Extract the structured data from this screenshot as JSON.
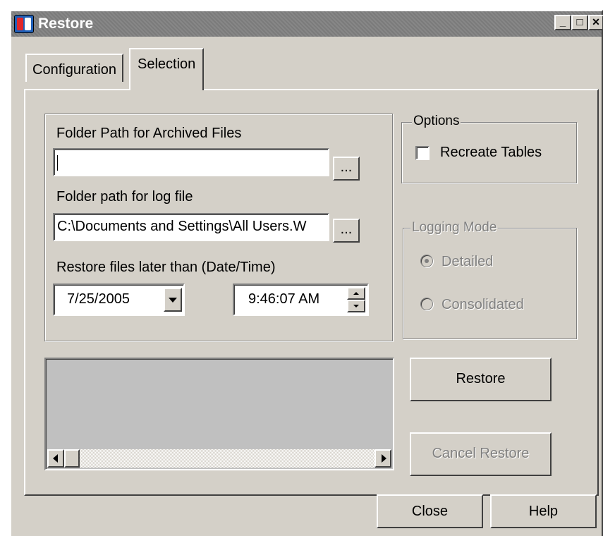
{
  "window": {
    "title": "Restore",
    "minimize_glyph": "_",
    "maximize_glyph": "□",
    "close_glyph": "✕"
  },
  "tabs": [
    {
      "label": "Configuration",
      "active": false
    },
    {
      "label": "Selection",
      "active": true
    }
  ],
  "selection": {
    "archived_folder_label": "Folder Path for Archived Files",
    "archived_folder_value": "",
    "log_folder_label": "Folder path for log file",
    "log_folder_value": "C:\\Documents and Settings\\All Users.W",
    "browse_label": "...",
    "date_time_label": "Restore files later than (Date/Time)",
    "date_value": "7/25/2005",
    "time_value": "9:46:07 AM"
  },
  "options": {
    "caption": "Options",
    "recreate_tables_label": "Recreate Tables",
    "recreate_tables_checked": false
  },
  "logging_mode": {
    "caption": "Logging Mode",
    "enabled": false,
    "options": [
      {
        "label": "Detailed",
        "selected": true
      },
      {
        "label": "Consolidated",
        "selected": false
      }
    ]
  },
  "actions": {
    "restore_label": "Restore",
    "cancel_restore_label": "Cancel Restore"
  },
  "footer": {
    "close_label": "Close",
    "help_label": "Help"
  },
  "colors": {
    "face": "#d4d0c8",
    "titlebar": "#808080",
    "disabled_text": "#808080",
    "output_area": "#c0c0c0"
  },
  "icons": [
    "app-icon",
    "chevron-down-icon",
    "spin-up-icon",
    "spin-down-icon",
    "scroll-left-icon",
    "scroll-right-icon"
  ]
}
